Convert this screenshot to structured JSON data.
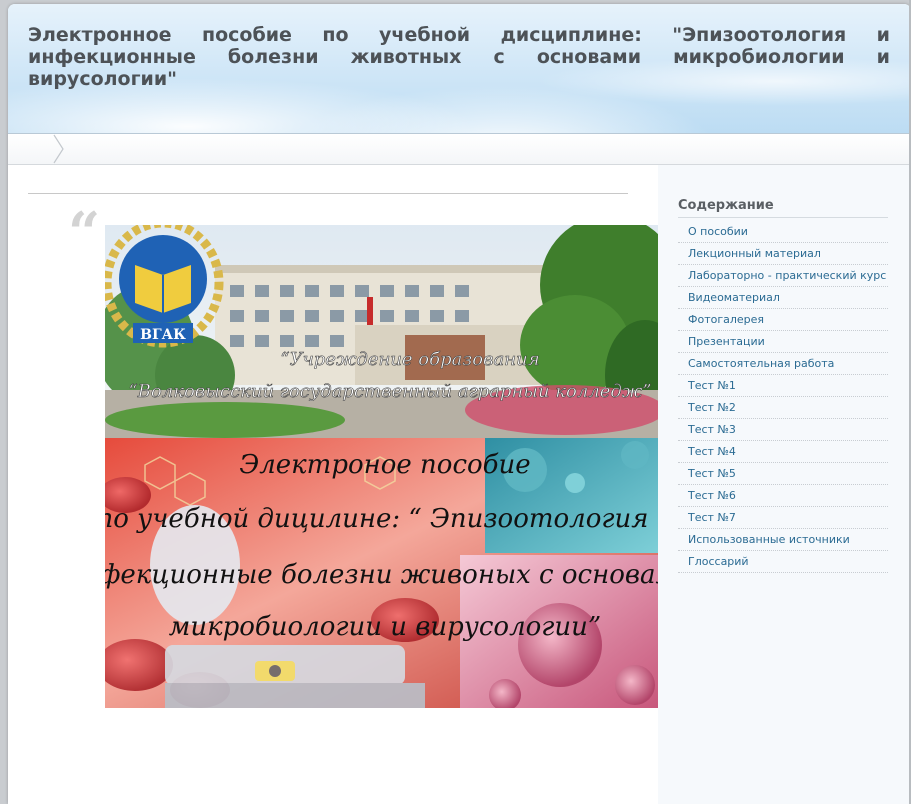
{
  "header": {
    "title": "Электронное пособие по учебной дисциплине: \"Эпизоотология и инфекционные болезни животных с основами микробиологии и вирусологии\""
  },
  "content": {
    "quote_mark": "“",
    "banner": {
      "logo_text": "ВГАК",
      "institution_line1": "“Учреждение образования",
      "institution_line2": "“Волковысский государственный аграрный колледж”",
      "headline_line1": "Электроное пособие",
      "headline_line2": "по учебной дицилине: “ Эпизоотология и",
      "headline_line3": "инфекционные болезни живоных с основами",
      "headline_line4": "микробиологии и вирусологии”"
    }
  },
  "sidebar": {
    "title": "Содержание",
    "items": [
      {
        "label": "О пособии"
      },
      {
        "label": "Лекционный материал"
      },
      {
        "label": "Лабораторно - практический курс"
      },
      {
        "label": "Видеоматериал"
      },
      {
        "label": "Фотогалерея"
      },
      {
        "label": "Презентации"
      },
      {
        "label": "Самостоятельная работа"
      },
      {
        "label": "Тест №1"
      },
      {
        "label": "Тест №2"
      },
      {
        "label": "Тест №3"
      },
      {
        "label": "Тест №4"
      },
      {
        "label": "Тест №5"
      },
      {
        "label": "Тест №6"
      },
      {
        "label": "Тест №7"
      },
      {
        "label": "Использованные источники"
      },
      {
        "label": "Глоссарий"
      }
    ]
  },
  "colors": {
    "link": "#2b6b93",
    "title_text": "#4d5257",
    "sidebar_bg": "#f6f9fc",
    "header_sky": "#cfe6f7"
  }
}
